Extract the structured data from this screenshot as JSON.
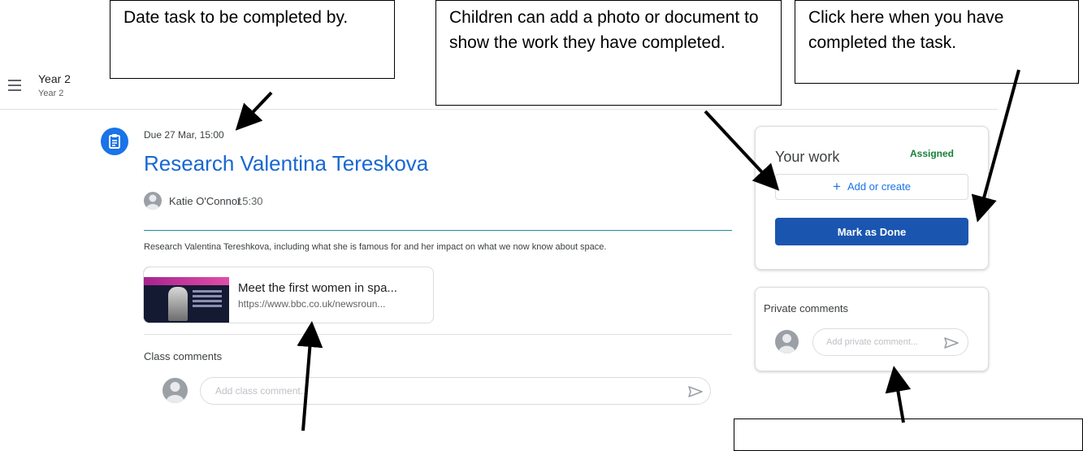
{
  "header": {
    "class_name": "Year 2",
    "class_subtitle": "Year 2"
  },
  "assignment": {
    "due": "Due 27 Mar, 15:00",
    "title": "Research Valentina Tereskova",
    "author": "Katie O'Connor",
    "posted_time": "15:30",
    "description": "Research Valentina Tereshkova, including what she is famous for and her impact on what we now know about space.",
    "attachment": {
      "title": "Meet the first women in spa...",
      "url": "https://www.bbc.co.uk/newsroun..."
    }
  },
  "class_comments": {
    "label": "Class comments",
    "placeholder": "Add class comment..."
  },
  "your_work": {
    "title": "Your work",
    "status": "Assigned",
    "add_label": "Add or create",
    "done_label": "Mark as Done"
  },
  "private_comments": {
    "label": "Private comments",
    "placeholder": "Add private comment..."
  },
  "annotations": {
    "date": "Date task to be completed by.",
    "children": "Children can add a photo or document to show the work they have completed.",
    "click": "Click here when you have completed the task."
  },
  "colors": {
    "accent": "#1a73e8",
    "title": "#1967d2",
    "status": "#188038",
    "done_button": "#1a56b0"
  },
  "icons": [
    "menu-icon",
    "assignment-icon",
    "plus-icon",
    "send-icon",
    "person-icon"
  ]
}
